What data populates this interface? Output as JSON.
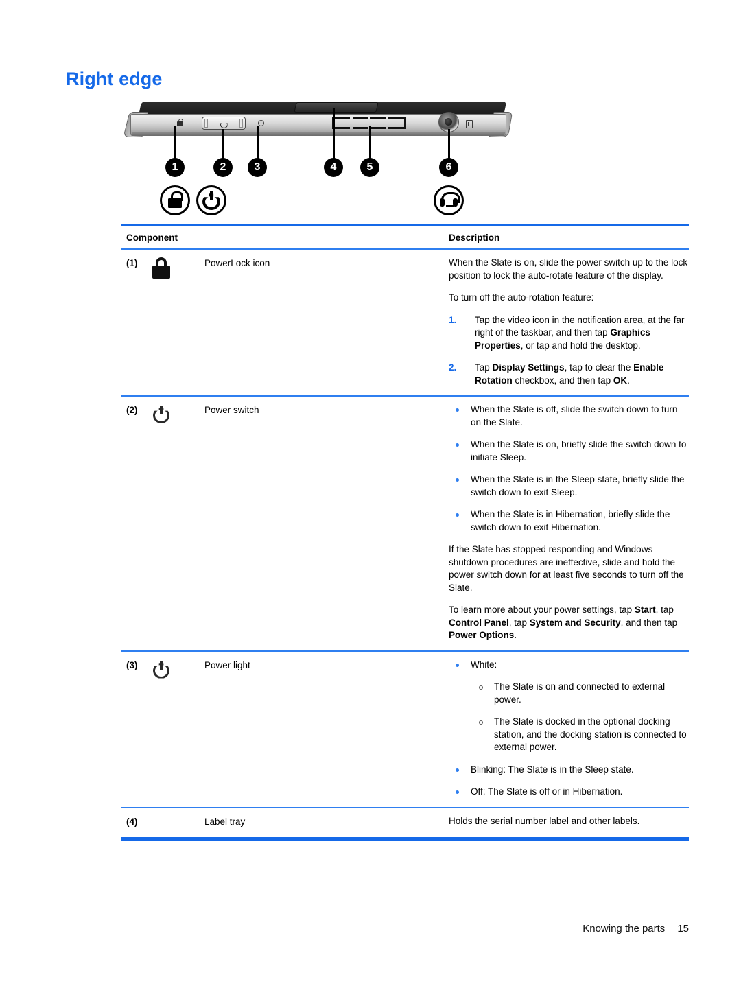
{
  "heading": "Right edge",
  "figure": {
    "callouts": [
      "1",
      "2",
      "3",
      "4",
      "5",
      "6"
    ],
    "icons": [
      "lock-icon",
      "power-icon",
      "headset-icon"
    ]
  },
  "table": {
    "headers": {
      "component": "Component",
      "description": "Description"
    },
    "rows": [
      {
        "num": "(1)",
        "icon": "lock-icon",
        "name": "PowerLock icon",
        "desc": {
          "p1": "When the Slate is on, slide the power switch up to the lock position to lock the auto-rotate feature of the display.",
          "p2": "To turn off the auto-rotation feature:",
          "steps": [
            {
              "marker": "1.",
              "t1": "Tap the video icon in the notification area, at the far right of the taskbar, and then tap ",
              "b1": "Graphics Properties",
              "t2": ", or tap and hold the desktop."
            },
            {
              "marker": "2.",
              "t1": "Tap ",
              "b1": "Display Settings",
              "t2": ", tap to clear the ",
              "b2": "Enable Rotation",
              "t3": " checkbox, and then tap ",
              "b3": "OK",
              "t4": "."
            }
          ]
        }
      },
      {
        "num": "(2)",
        "icon": "power-icon",
        "name": "Power switch",
        "desc": {
          "bullets": [
            "When the Slate is off, slide the switch down to turn on the Slate.",
            "When the Slate is on, briefly slide the switch down to initiate Sleep.",
            "When the Slate is in the Sleep state, briefly slide the switch down to exit Sleep.",
            "When the Slate is in Hibernation, briefly slide the switch down to exit Hibernation."
          ],
          "p1": "If the Slate has stopped responding and Windows shutdown procedures are ineffective, slide and hold the power switch down for at least five seconds to turn off the Slate.",
          "p2": {
            "t1": "To learn more about your power settings, tap ",
            "b1": "Start",
            "t2": ", tap ",
            "b2": "Control Panel",
            "t3": ", tap ",
            "b3": "System and Security",
            "t4": ", and then tap ",
            "b4": "Power Options",
            "t5": "."
          }
        }
      },
      {
        "num": "(3)",
        "icon": "power-icon",
        "name": "Power light",
        "desc": {
          "white_label": "White:",
          "sub": [
            "The Slate is on and connected to external power.",
            "The Slate is docked in the optional docking station, and the docking station is connected to external power."
          ],
          "blinking": "Blinking: The Slate is in the Sleep state.",
          "off": "Off: The Slate is off or in Hibernation."
        }
      },
      {
        "num": "(4)",
        "icon": "",
        "name": "Label tray",
        "desc": {
          "p1": "Holds the serial number label and other labels."
        }
      }
    ]
  },
  "footer": {
    "chapter": "Knowing the parts",
    "page": "15"
  },
  "colors": {
    "accent": "#1569e8",
    "rule": "#2f7ff0"
  }
}
